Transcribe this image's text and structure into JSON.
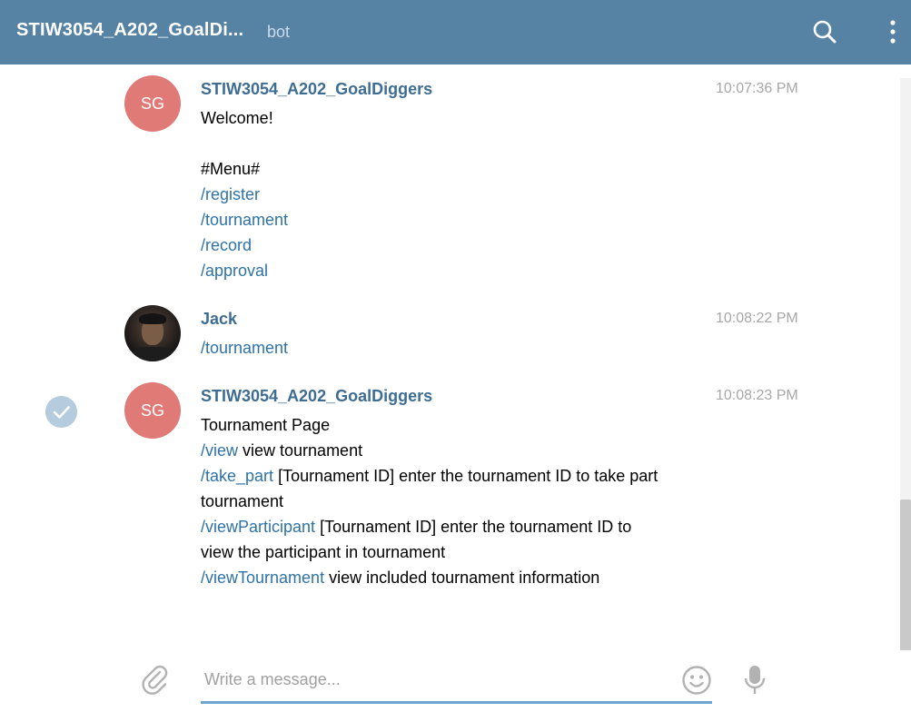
{
  "header": {
    "title": "STIW3054_A202_GoalDi...",
    "subtitle": "bot",
    "search_icon": "search-icon",
    "menu_icon": "kebab-menu-icon",
    "bg_color": "#5682a3"
  },
  "messages": [
    {
      "sender": "STIW3054_A202_GoalDiggers",
      "avatar_text": "SG",
      "time": "10:07:36 PM",
      "lines": [
        "Welcome!",
        "#Menu#"
      ],
      "commands": [
        "/register",
        "/tournament",
        "/record",
        "/approval"
      ]
    },
    {
      "sender": "Jack",
      "time": "10:08:22 PM",
      "commands": [
        "/tournament"
      ]
    },
    {
      "sender": "STIW3054_A202_GoalDiggers",
      "avatar_text": "SG",
      "time": "10:08:23 PM",
      "lines": [
        "Tournament Page",
        " view tournament",
        " [Tournament ID] enter the tournament ID to take part",
        "tournament",
        " [Tournament ID] enter the tournament ID to",
        "view the participant in tournament",
        " view included tournament information"
      ],
      "commands": [
        "/view",
        "/take_part",
        "/viewParticipant",
        "/viewTournament"
      ]
    }
  ],
  "composer": {
    "placeholder": "Write a message...",
    "value": "",
    "attach_icon": "paperclip-icon",
    "emoji_icon": "smiley-icon",
    "mic_icon": "microphone-icon"
  },
  "colors": {
    "accent": "#5682a3",
    "link": "#2e73a8",
    "sender": "#3e6d93",
    "avatar_sg": "#e07a76",
    "timestamp": "#a7a7a7",
    "input_underline": "#6da5d0"
  }
}
